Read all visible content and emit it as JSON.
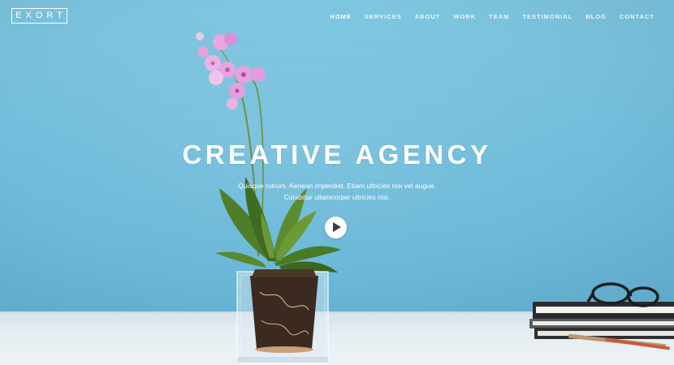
{
  "brand": {
    "logo_text": "EXORT"
  },
  "nav": {
    "items": [
      {
        "label": "HOME",
        "active": true
      },
      {
        "label": "SERVICES",
        "active": false
      },
      {
        "label": "ABOUT",
        "active": false
      },
      {
        "label": "WORK",
        "active": false
      },
      {
        "label": "TEAM",
        "active": false
      },
      {
        "label": "TESTIMONIAL",
        "active": false
      },
      {
        "label": "BLOG",
        "active": false
      },
      {
        "label": "CONTACT",
        "active": false
      }
    ]
  },
  "hero": {
    "headline": "CREATIVE AGENCY",
    "subtitle_line1": "Quisque rutrum. Aenean imperdiet. Etiam ultricies nisi vel augue.",
    "subtitle_line2": "Curabitur ullamcorper ultricies nisi.",
    "play_icon": "play-icon"
  },
  "colors": {
    "background": "#72bfdd",
    "text": "#ffffff",
    "play_button": "#ffffff",
    "play_triangle": "#3d3d3d"
  }
}
